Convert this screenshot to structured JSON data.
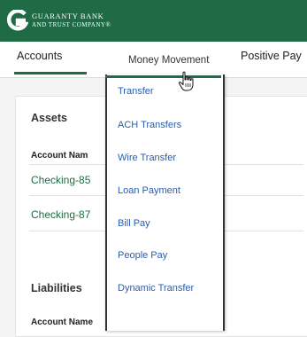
{
  "brand": {
    "line1": "GUARANTY BANK",
    "line2": "AND TRUST COMPANY®",
    "header_color": "#1e6b45"
  },
  "nav": {
    "tabs": [
      {
        "label": "Accounts"
      },
      {
        "label": "Money Movement"
      },
      {
        "label": "Positive Pay"
      }
    ]
  },
  "assets": {
    "title": "Assets",
    "column_header": "Account Nam",
    "accounts": [
      "Checking-85",
      "Checking-87"
    ]
  },
  "liabilities": {
    "title": "Liabilities",
    "column_header": "Account Name"
  },
  "money_movement_menu": {
    "items": [
      {
        "label": "Transfer"
      },
      {
        "label": "ACH Transfers"
      },
      {
        "label": "Wire Transfer"
      },
      {
        "label": "Loan Payment"
      },
      {
        "label": "Bill Pay"
      },
      {
        "label": "People Pay"
      },
      {
        "label": "Dynamic Transfer"
      }
    ]
  }
}
